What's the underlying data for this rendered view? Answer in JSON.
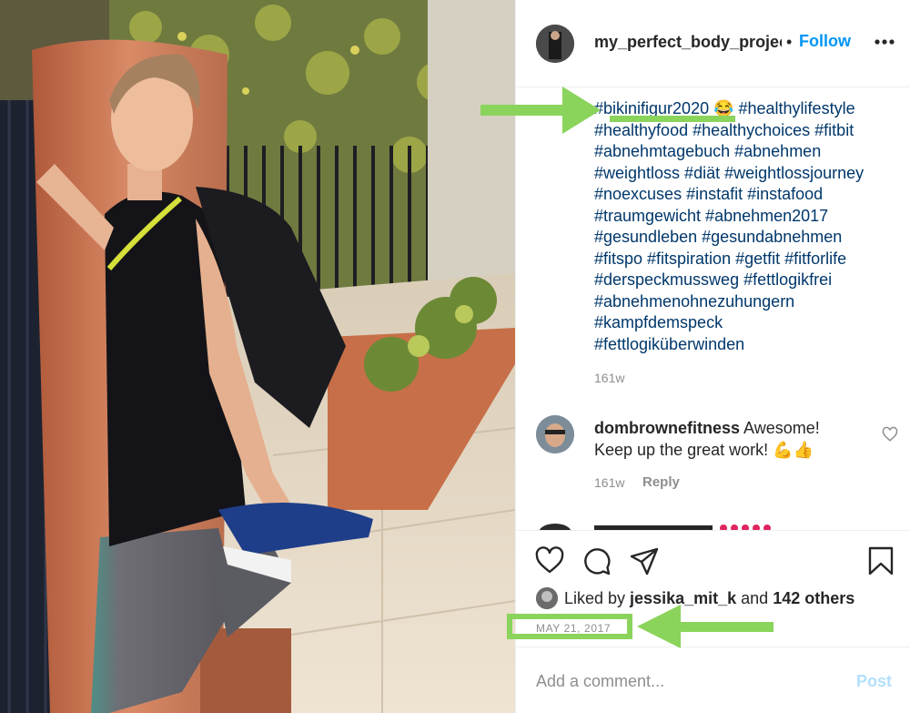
{
  "post": {
    "username": "my_perfect_body_projec",
    "dot": "•",
    "follow_label": "Follow",
    "more_label": "•••"
  },
  "caption": {
    "first_tag": "#bikinifigur2020",
    "first_tail": " 😂 #healthylifestyle",
    "lines": [
      "#healthyfood #healthychoices #fitbit",
      "#abnehmtagebuch #abnehmen",
      "#weightloss #diät #weightlossjourney",
      "#noexcuses #instafit #instafood",
      "#traumgewicht #abnehmen2017",
      "#gesundleben #gesundabnehmen",
      "#fitspo #fitspiration #getfit #fitforlife",
      "#derspeckmussweg #fettlogikfrei",
      "#abnehmenohnezuhungern",
      "#kampfdemspeck",
      "#fettlogiküberwinden"
    ],
    "time": "161w"
  },
  "comment": {
    "username": "dombrownefitness",
    "text_1": " Awesome!",
    "text_2": "Keep up the great work! 💪👍",
    "time": "161w",
    "reply_label": "Reply"
  },
  "likes": {
    "prefix": "Liked by ",
    "user": "jessika_mit_k",
    "middle": " and ",
    "others": "142 others"
  },
  "date": "MAY 21, 2017",
  "add_comment": {
    "placeholder": "Add a comment...",
    "post_label": "Post"
  },
  "colors": {
    "link_blue": "#0095f6",
    "hashtag": "#00376b",
    "muted": "#8e8e8e",
    "annotation_green": "#8bd45c"
  },
  "icons": [
    "heart-icon",
    "comment-icon",
    "share-icon",
    "bookmark-icon",
    "more-icon",
    "heart-small-icon"
  ]
}
